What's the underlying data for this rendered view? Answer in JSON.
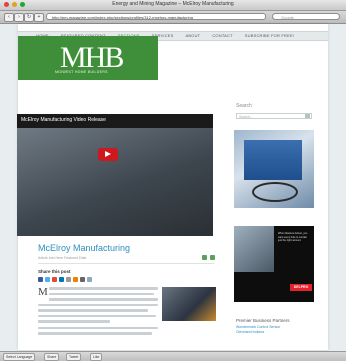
{
  "window": {
    "title": "Energy and Mining Magazine – McElroy Manufacturing"
  },
  "toolbar": {
    "url": "http://em-magazine.com/index.php/sections/profiles/312-mcelroy-manufacturing",
    "search_placeholder": "Google"
  },
  "menu": {
    "items": [
      "HOME",
      "FEATURED CONTENT",
      "SECTIONS",
      "SERVICES",
      "ABOUT",
      "CONTACT",
      "SUBSCRIBE FOR FREE!"
    ],
    "active_index": 2
  },
  "logo": {
    "text": "MHB",
    "subtitle": "MIDWEST HOME BUILDERS"
  },
  "video": {
    "title": "McElroy Manufacturing Video Release"
  },
  "article": {
    "title": "McElroy Manufacturing",
    "meta": "Article Info Here    Featured Date",
    "share_label": "Share this post",
    "dropcap": "M"
  },
  "sidebar": {
    "search_label": "Search",
    "search_placeholder": "Search...",
    "partners_title": "Premier Business Partners",
    "partners": [
      "Wondermark Control Sensor",
      "Cleveland Indiana"
    ]
  },
  "ad2": {
    "text": "When blasters deliver, you want every hole to contain just the right amount.",
    "logo": "DELPRO"
  },
  "statusbar": {
    "buttons": [
      "Select Language",
      "Share",
      "Tweet",
      "Like"
    ]
  }
}
